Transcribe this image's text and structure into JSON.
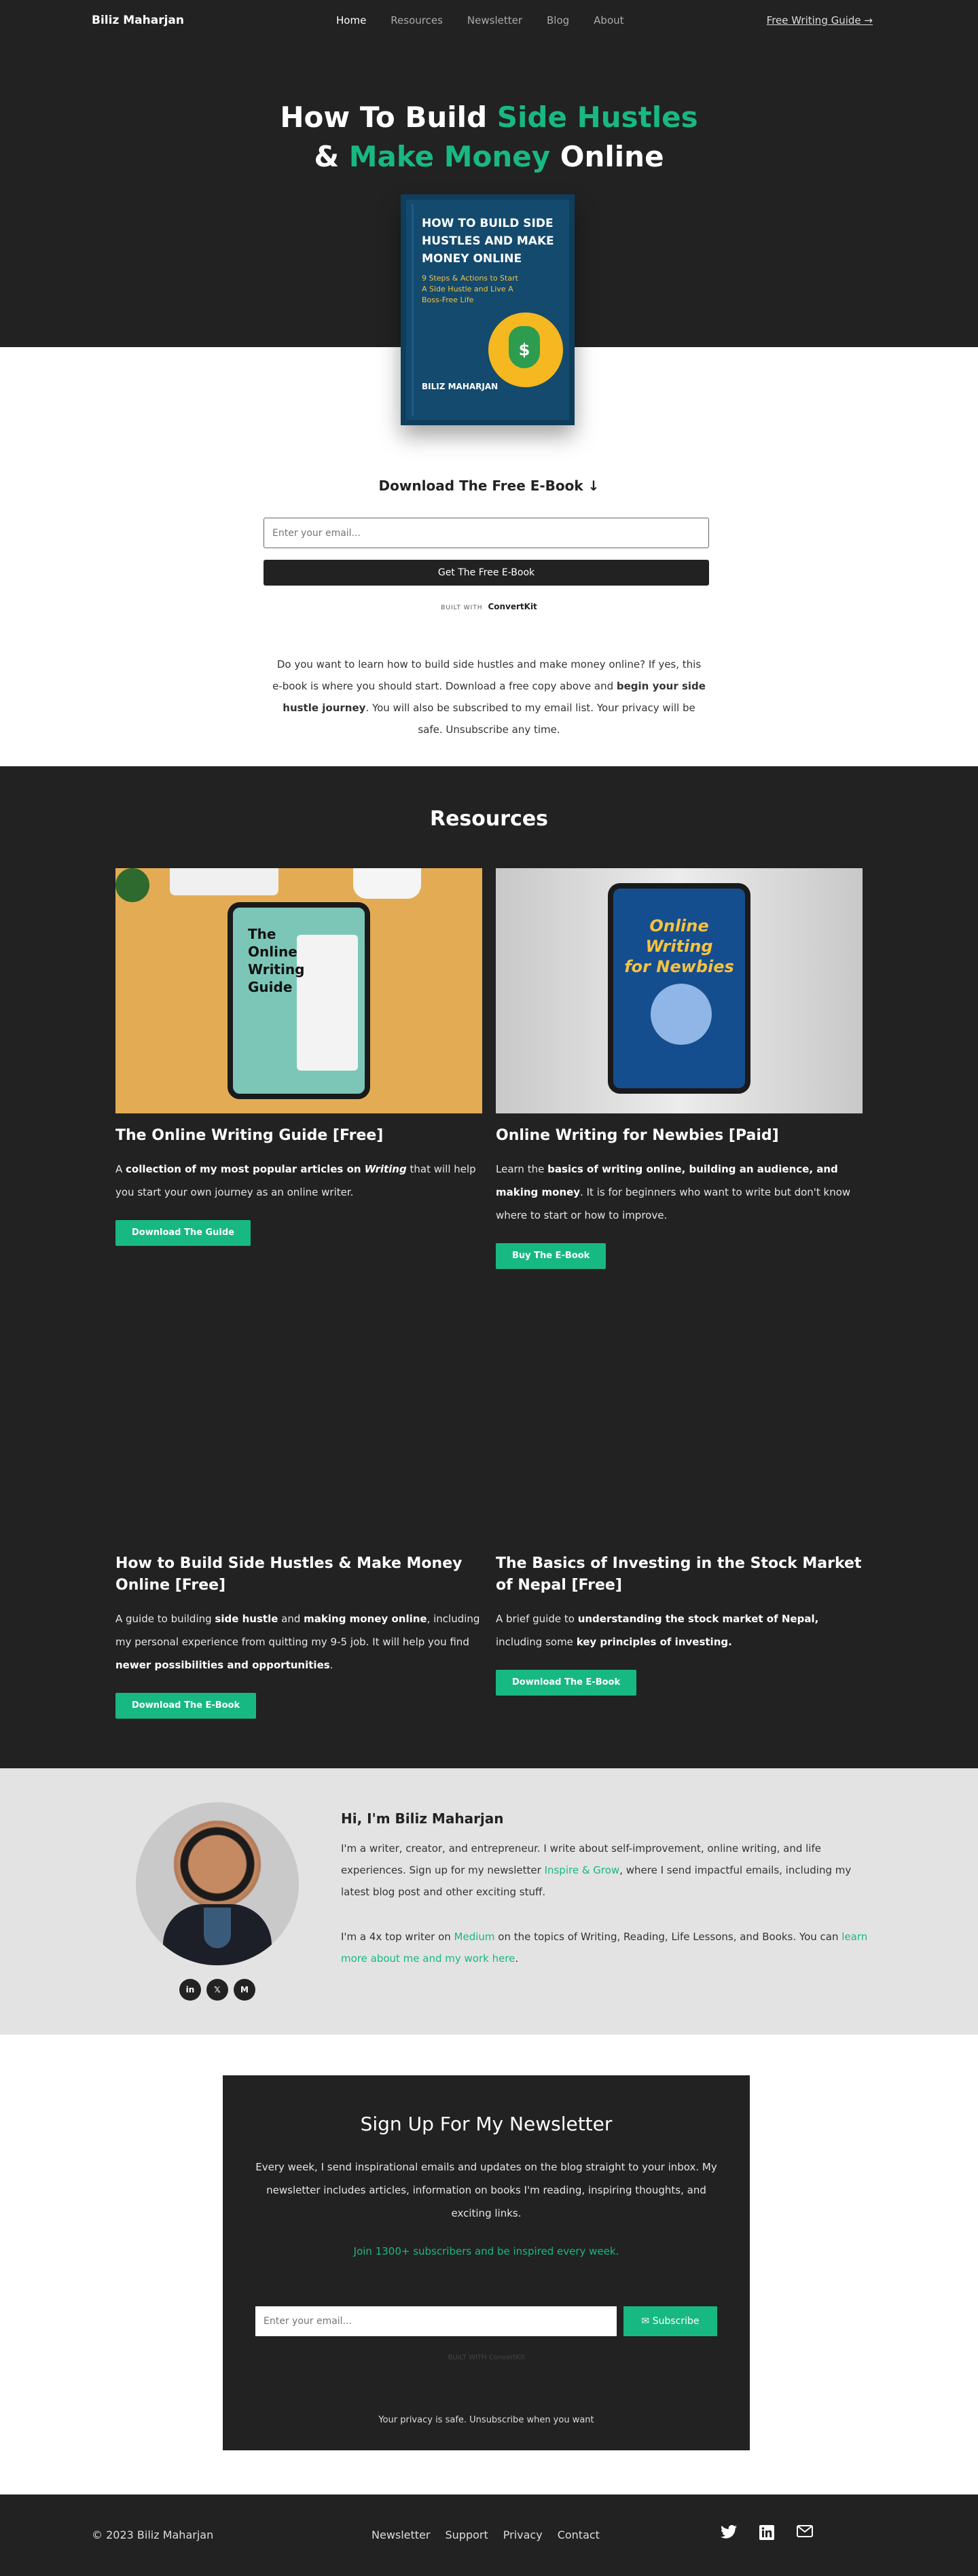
{
  "nav": {
    "brand": "Biliz Maharjan",
    "items": [
      "Home",
      "Resources",
      "Newsletter",
      "Blog",
      "About"
    ],
    "cta": "Free Writing Guide →"
  },
  "hero": {
    "title_part1": "How To Build ",
    "title_hl1": "Side Hustles",
    "title_part2": "& ",
    "title_hl2": "Make Money",
    "title_part3": " Online",
    "book_title": "HOW TO BUILD SIDE HUSTLES AND MAKE MONEY ONLINE",
    "book_subtitle": "9 Steps & Actions to Start A Side Hustle and Live A Boss-Free Life",
    "book_author": "BILIZ MAHARJAN"
  },
  "optin": {
    "title": "Download The Free E-Book ↓",
    "email_placeholder": "Enter your email...",
    "button": "Get The Free E-Book",
    "built_with": "BUILT WITH",
    "built_brand": "ConvertKit",
    "intro_1": "Do you want to learn how to build side hustles and make money online? If yes, this e-book is where you should start. Download a free copy above and ",
    "intro_bold": "begin your side hustle journey",
    "intro_2": ". You will also be subscribed to my email list. Your privacy will be safe. Unsubscribe any time."
  },
  "resources": {
    "title": "Resources",
    "cards": [
      {
        "title": "The Online Writing Guide [Free]",
        "img_title": "The Online Writing Guide",
        "desc_1": "A ",
        "desc_b1": "collection of my most popular articles on ",
        "desc_i": "Writing",
        "desc_2": " that will help you start your own journey as an online writer.",
        "button": "Download The Guide"
      },
      {
        "title": "Online Writing for Newbies [Paid]",
        "img_title_1": "Online Writing",
        "img_title_2": "for Newbies",
        "desc_1": "Learn the ",
        "desc_b1": "basics of writing online, building an audience, and making money",
        "desc_2": ". It is for beginners who want to write but don't know where to start or how to improve.",
        "button": "Buy The E-Book"
      },
      {
        "title": "How to Build Side Hustles & Make Money Online [Free]",
        "desc_1": "A guide to building ",
        "desc_b1": "side hustle",
        "desc_2": " and ",
        "desc_b2": "making money online",
        "desc_3": ", including my personal experience from quitting my 9-5 job. It will help you find ",
        "desc_b3": "newer possibilities and opportunities",
        "desc_4": ".",
        "button": "Download The E-Book"
      },
      {
        "title": "The Basics of Investing in the Stock Market of Nepal [Free]",
        "desc_1": "A brief guide to ",
        "desc_b1": "understanding the stock market of Nepal,",
        "desc_2": " including some ",
        "desc_b2": "key principles of investing.",
        "button": "Download The E-Book"
      }
    ]
  },
  "about": {
    "name": "Hi, I'm Biliz Maharjan",
    "p1_1": "I'm a writer, creator, and entrepreneur. I write about self-improvement, online writing, and life experiences. Sign up for my newsletter ",
    "p1_link": "Inspire & Grow",
    "p1_2": ", where I send impactful emails, including my latest blog post and other exciting stuff.",
    "p2_1": "I'm a 4x top writer on ",
    "p2_link1": "Medium",
    "p2_2": " on the topics of Writing, Reading, Life Lessons, and Books. You can ",
    "p2_link2": "learn more about me and my work here",
    "p2_3": ".",
    "socials": [
      "in",
      "𝕏",
      "M"
    ]
  },
  "newsletter": {
    "title": "Sign Up For My Newsletter",
    "desc": "Every week, I send inspirational emails and updates on the blog straight to your inbox. My newsletter includes articles, information on books I'm reading, inspiring thoughts, and exciting links.",
    "join": "Join 1300+ subscribers and be inspired every week.",
    "email_placeholder": "Enter your email...",
    "button": "✉ Subscribe",
    "built": "BUILT WITH ConvertKit",
    "privacy": "Your privacy is safe. Unsubscribe when you want"
  },
  "footer": {
    "copyright": "© 2023 Biliz Maharjan",
    "links": [
      "Newsletter",
      "Support",
      "Privacy",
      "Contact"
    ],
    "icons": [
      "twitter-icon",
      "linkedin-icon",
      "mail-icon"
    ]
  },
  "colors": {
    "accent": "#18b883",
    "dark": "#222222",
    "light_section": "#e3e3e3"
  }
}
